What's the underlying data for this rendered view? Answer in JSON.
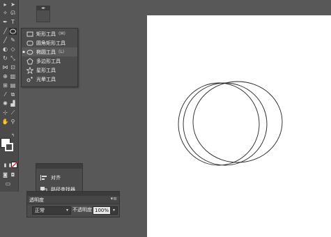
{
  "tool_panel": {
    "tearoff_glyph": "◂▸"
  },
  "shape_flyout": {
    "items": [
      {
        "label": "矩形工具",
        "shortcut": "(M)",
        "icon": "rectangle-icon",
        "selected": false
      },
      {
        "label": "圆角矩形工具",
        "shortcut": "",
        "icon": "rounded-rectangle-icon",
        "selected": false
      },
      {
        "label": "椭圆工具",
        "shortcut": "(L)",
        "icon": "ellipse-icon",
        "selected": true
      },
      {
        "label": "多边形工具",
        "shortcut": "",
        "icon": "polygon-icon",
        "selected": false
      },
      {
        "label": "星形工具",
        "shortcut": "",
        "icon": "star-icon",
        "selected": false
      },
      {
        "label": "光晕工具",
        "shortcut": "",
        "icon": "flare-icon",
        "selected": false
      }
    ],
    "selected_mark": "▪"
  },
  "align_panel": {
    "items": [
      {
        "label": "对齐",
        "icon": "align-icon"
      },
      {
        "label": "路径查找器",
        "icon": "pathfinder-icon"
      }
    ]
  },
  "transparency_panel": {
    "title": "透明度",
    "menu_glyph": "▾≡",
    "blend_mode": "正常",
    "opacity_label": "不透明度",
    "opacity_value": "100%",
    "dropdown_glyph": "▾"
  },
  "colors": {
    "workspace": "#585858",
    "panel": "#4c4c4c",
    "artboard": "#ffffff",
    "stroke": "#222222"
  }
}
